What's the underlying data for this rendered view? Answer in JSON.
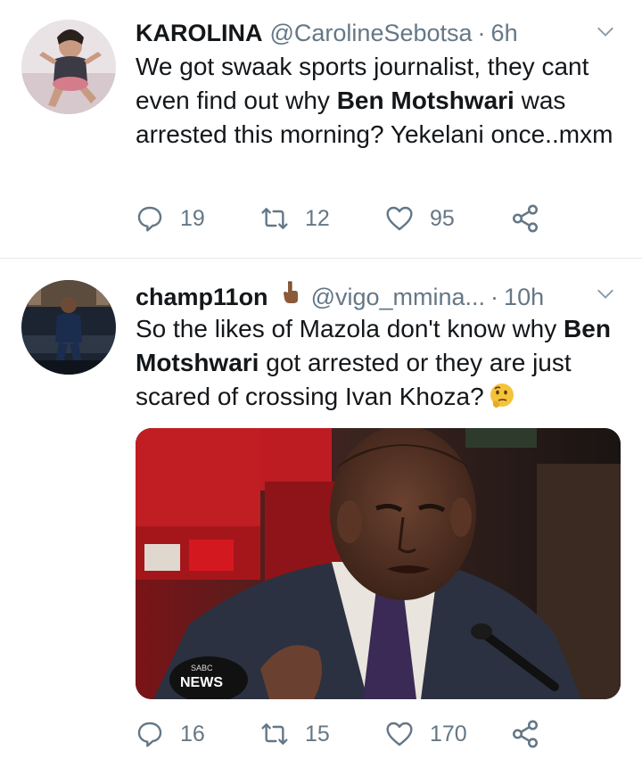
{
  "tweets": [
    {
      "display_name": "KAROLINA",
      "handle": "@CarolineSebotsa",
      "separator": "·",
      "time": "6h",
      "text_before": "We got swaak sports journalist, they cant even find out why ",
      "text_bold": "Ben Motshwari",
      "text_after": " was arrested this morning? Yekelani once..mxm",
      "replies": "19",
      "retweets": "12",
      "likes": "95"
    },
    {
      "display_name": "champ11on",
      "handle": "@vigo_mmina...",
      "separator": "·",
      "time": "10h",
      "text_before": "So the likes of Mazola don't know why ",
      "text_bold": "Ben Motshwari",
      "text_after": " got arrested or they are just scared of crossing Ivan Khoza?",
      "media_logo": "NEWS",
      "media_logo_small": "SABC",
      "replies": "16",
      "retweets": "15",
      "likes": "170"
    }
  ],
  "colors": {
    "text": "#14171a",
    "secondary": "#657786",
    "divider": "#e6ecf0"
  },
  "icons": {
    "reply": "reply-icon",
    "retweet": "retweet-icon",
    "like": "heart-icon",
    "share": "share-icon",
    "caret": "chevron-down-icon"
  }
}
